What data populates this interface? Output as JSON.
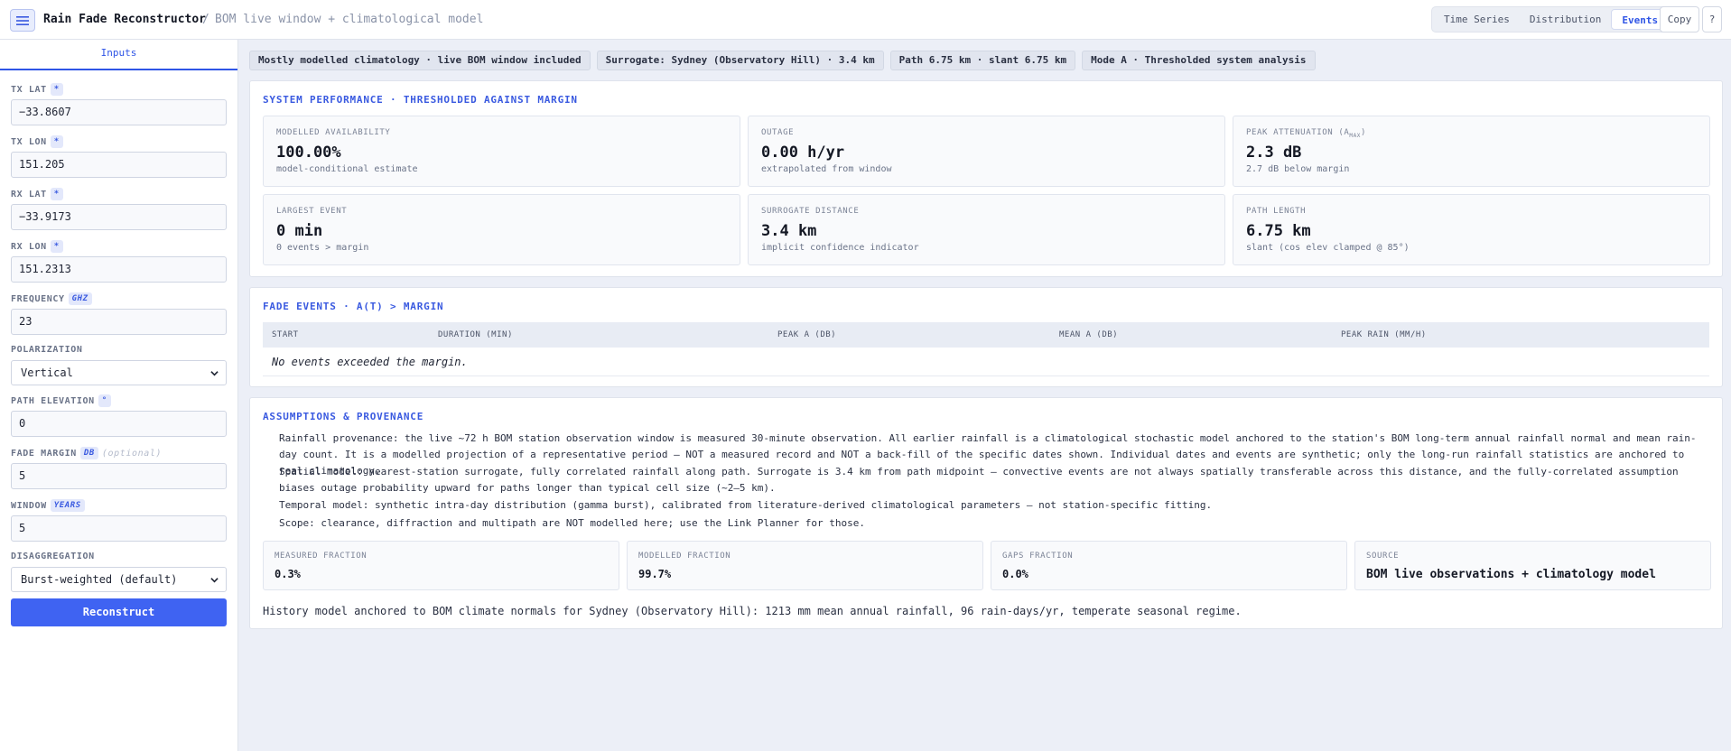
{
  "header": {
    "app_title": "Rain Fade Reconstructor",
    "separator": "/",
    "subtitle": "BOM live window + climatological model",
    "view_tabs": [
      {
        "label": "Time Series",
        "active": false
      },
      {
        "label": "Distribution",
        "active": false
      },
      {
        "label": "Events",
        "active": true
      }
    ],
    "copy_label": "Copy",
    "help_label": "?"
  },
  "sidebar": {
    "tab_label": "Inputs",
    "fields": {
      "tx_lat": {
        "label": "TX LAT",
        "badge": "*",
        "value": "−33.8607"
      },
      "tx_lon": {
        "label": "TX LON",
        "badge": "*",
        "value": "151.205"
      },
      "rx_lat": {
        "label": "RX LAT",
        "badge": "*",
        "value": "−33.9173"
      },
      "rx_lon": {
        "label": "RX LON",
        "badge": "*",
        "value": "151.2313"
      },
      "frequency": {
        "label": "FREQUENCY",
        "badge": "GHZ",
        "value": "23"
      },
      "polarization": {
        "label": "POLARIZATION",
        "value": "Vertical"
      },
      "path_elevation": {
        "label": "PATH ELEVATION",
        "badge": "°",
        "value": "0"
      },
      "fade_margin": {
        "label": "FADE MARGIN",
        "badge": "DB",
        "optional": "(optional)",
        "value": "5"
      },
      "window": {
        "label": "WINDOW",
        "badge": "YEARS",
        "value": "5"
      },
      "disaggregation": {
        "label": "DISAGGREGATION",
        "value": "Burst-weighted (default)"
      }
    },
    "reconstruct_label": "Reconstruct"
  },
  "chips": [
    "Mostly modelled climatology · live BOM window included",
    "Surrogate: Sydney (Observatory Hill) · 3.4 km",
    "Path 6.75 km · slant 6.75 km",
    "Mode A · Thresholded system analysis"
  ],
  "performance": {
    "title": "SYSTEM PERFORMANCE · THRESHOLDED AGAINST MARGIN",
    "metrics": [
      {
        "label": "MODELLED AVAILABILITY",
        "value": "100.00%",
        "sub": "model-conditional estimate"
      },
      {
        "label": "OUTAGE",
        "value": "0.00 h/yr",
        "sub": "extrapolated from window"
      },
      {
        "label": "PEAK ATTENUATION (A",
        "label_sub": "MAX",
        "label_end": ")",
        "value": "2.3 dB",
        "sub": "2.7 dB below margin"
      },
      {
        "label": "LARGEST EVENT",
        "value": "0 min",
        "sub": "0 events > margin"
      },
      {
        "label": "SURROGATE DISTANCE",
        "value": "3.4 km",
        "sub": "implicit confidence indicator"
      },
      {
        "label": "PATH LENGTH",
        "value": "6.75 km",
        "sub": "slant (cos elev clamped @ 85°)"
      }
    ]
  },
  "fade_events": {
    "title": "FADE EVENTS · A(T) > MARGIN",
    "columns": [
      "START",
      "DURATION (MIN)",
      "PEAK A (DB)",
      "MEAN A (DB)",
      "PEAK RAIN (MM/H)"
    ],
    "empty_message": "No events exceeded the margin."
  },
  "assumptions": {
    "title": "ASSUMPTIONS & PROVENANCE",
    "rainfall_provenance": "Rainfall provenance: the live ~72 h BOM station observation window is measured 30-minute observation. All earlier rainfall is a climatological stochastic model anchored to the station's BOM long-term annual rainfall normal and mean rain-day count. It is a modelled projection of a representative period — NOT a measured record and NOT a back-fill of the specific dates shown. Individual dates and events are synthetic; only the long-run rainfall statistics are anchored to real climatology.",
    "spatial_model": "Spatial model: nearest-station surrogate, fully correlated rainfall along path. Surrogate is 3.4 km from path midpoint — convective events are not always spatially transferable across this distance, and the fully-correlated assumption biases outage probability upward for paths longer than typical cell size (~2–5 km).",
    "temporal_model": "Temporal model: synthetic intra-day distribution (gamma burst), calibrated from literature-derived climatological parameters — not station-specific fitting.",
    "scope": "Scope: clearance, diffraction and multipath are NOT modelled here; use the Link Planner for those.",
    "fractions": [
      {
        "label": "MEASURED FRACTION",
        "value": "0.3%"
      },
      {
        "label": "MODELLED FRACTION",
        "value": "99.7%"
      },
      {
        "label": "GAPS FRACTION",
        "value": "0.0%"
      },
      {
        "label": "SOURCE",
        "value": "BOM live observations + climatology model"
      }
    ],
    "history": "History model anchored to BOM climate normals for Sydney (Observatory Hill): 1213 mm mean annual rainfall, 96 rain-days/yr, temperate seasonal regime."
  },
  "colors": {
    "accent": "#3f63f2",
    "background": "#eceff7",
    "card": "#ffffff"
  }
}
